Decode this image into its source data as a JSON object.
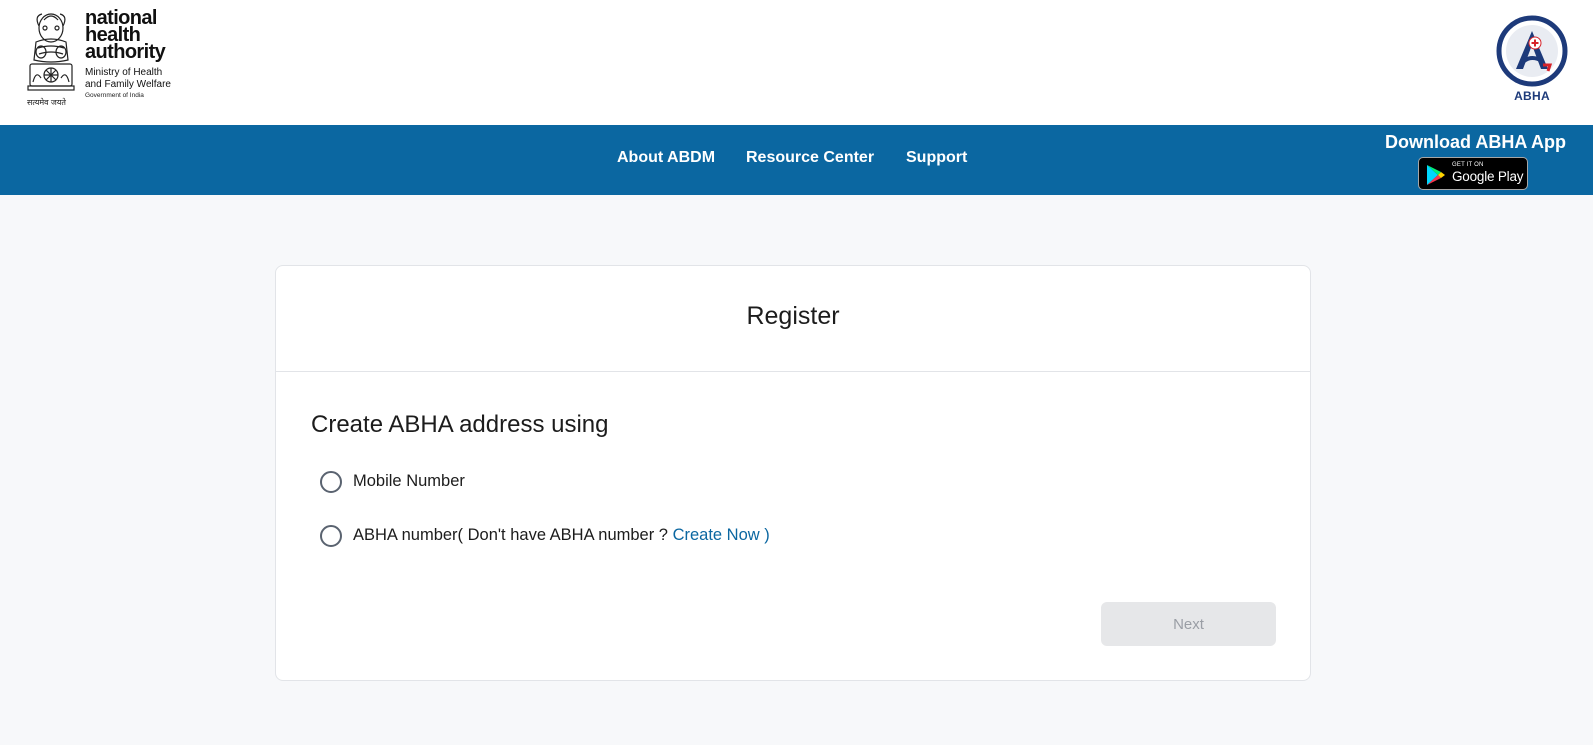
{
  "header": {
    "nha_logo": {
      "title": "national\nhealth\nauthority",
      "ministry": "Ministry of Health\nand Family Welfare",
      "government": "Government of India",
      "motto": "सत्यमेव जयते"
    },
    "abha_logo_label": "ABHA"
  },
  "nav": {
    "links": [
      {
        "label": "About ABDM"
      },
      {
        "label": "Resource Center"
      },
      {
        "label": "Support"
      }
    ],
    "download_title": "Download ABHA App",
    "google_play": {
      "small": "GET IT ON",
      "big": "Google Play"
    }
  },
  "card": {
    "title": "Register",
    "section_title": "Create ABHA address using",
    "options": [
      {
        "label": "Mobile Number",
        "selected": false
      },
      {
        "label_prefix": "ABHA number( Don't have ABHA number ? ",
        "link_text": "Create Now )",
        "selected": false
      }
    ],
    "next_button": {
      "label": "Next",
      "disabled": true
    }
  },
  "colors": {
    "nav_bg": "#0b67a1",
    "link": "#0b67a1",
    "abha_navy": "#1d3a7a",
    "page_bg": "#f7f8fa"
  }
}
